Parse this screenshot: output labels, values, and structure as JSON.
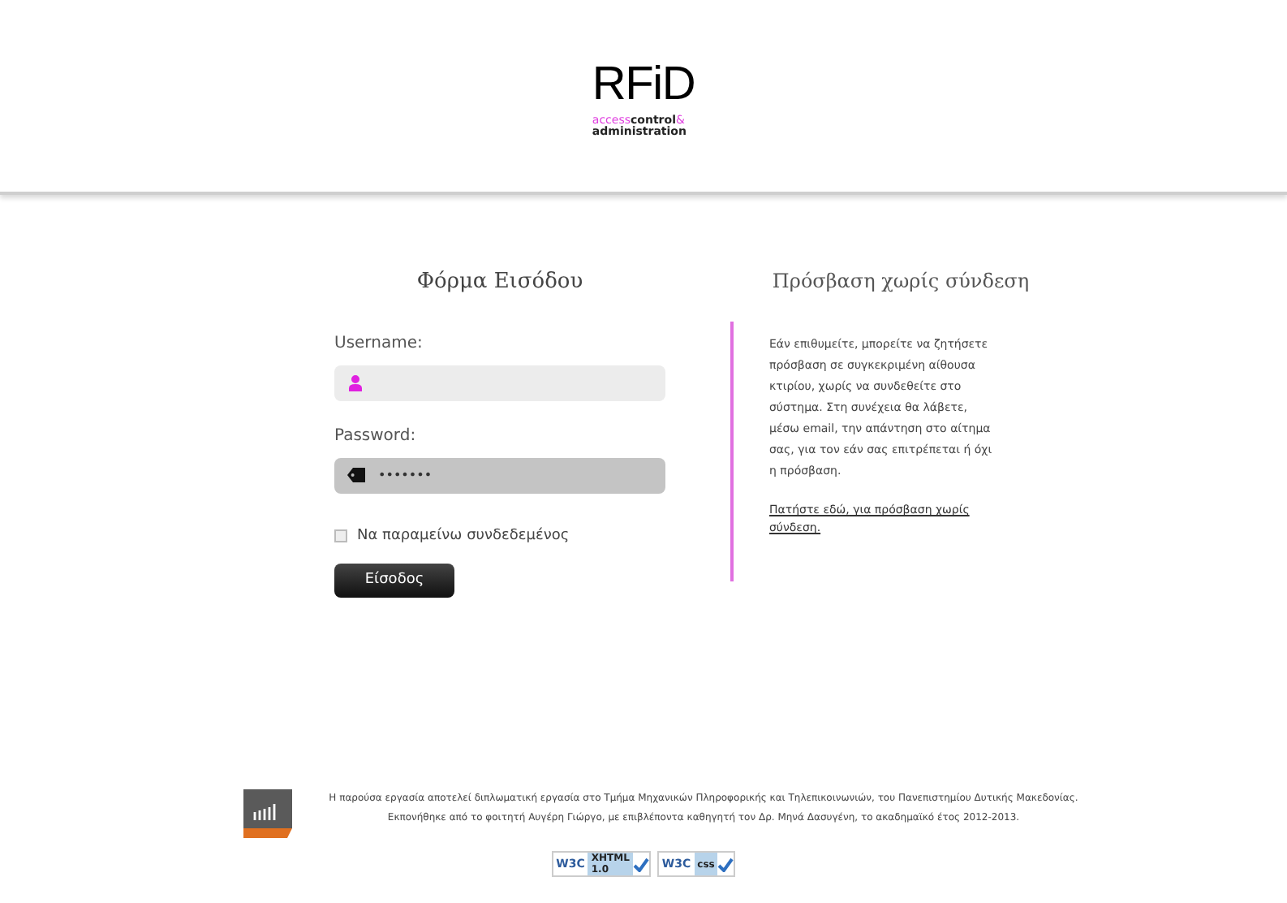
{
  "logo": {
    "title": "RFiD",
    "tagline": [
      {
        "text": "access",
        "accent": true
      },
      {
        "text": "control",
        "accent": false
      },
      {
        "text": "&",
        "accent": true
      }
    ],
    "subtitle": "administration"
  },
  "login": {
    "heading": "Φόρμα Εισόδου",
    "fields": [
      {
        "label": "Username:",
        "kind": "user"
      },
      {
        "label": "Password:",
        "kind": "password",
        "value": "•••••••"
      }
    ],
    "remember": {
      "label": "Να παραμείνω συνδεδεμένος",
      "checked": false
    },
    "submit": "Είσοδος"
  },
  "guest": {
    "heading": "Πρόσβαση χωρίς σύνδεση",
    "text": "Εάν επιθυμείτε, μπορείτε να ζητήσετε πρόσβαση σε συγκεκριμένη αίθουσα κτιρίου, χωρίς να συνδεθείτε στο σύστημα. Στη συνέχεια θα λάβετε, μέσω email, την απάντηση στο αίτημα σας, για τον εάν σας επιτρέπεται ή όχι η πρόσβαση.",
    "link": "Πατήστε εδώ, για πρόσβαση χωρίς σύνδεση."
  },
  "footer": {
    "text": "Η παρούσα εργασία αποτελεί διπλωματική εργασία στο Τμήμα Μηχανικών Πληροφορικής και Τηλεπικοινωνιών, του Πανεπιστημίου Δυτικής Μακεδονίας. Εκπονήθηκε από το φοιτητή Αυγέρη Γιώργο, με επιβλέποντα καθηγητή τον Δρ. Μηνά Δασυγένη, το ακαδημαϊκό έτος 2012-2013.",
    "badges": [
      {
        "brand": "W3C",
        "label": "XHTML",
        "version": "1.0"
      },
      {
        "brand": "W3C",
        "label": "css"
      }
    ]
  }
}
